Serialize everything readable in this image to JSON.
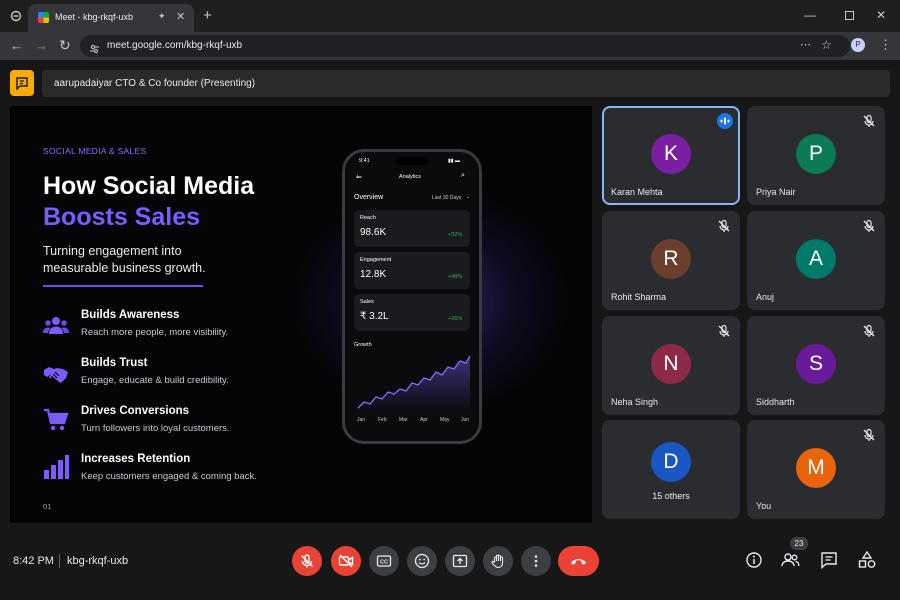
{
  "browser": {
    "tab_title": "Meet - kbg-rkqf-uxb",
    "url": "meet.google.com/kbg-rkqf-uxb",
    "profile_initial": "P"
  },
  "meet": {
    "presenting_label": "aarupadaiyar CTO & Co founder (Presenting)",
    "time": "8:42 PM",
    "meeting_code": "kbg-rkqf-uxb",
    "people_count": "23"
  },
  "slide": {
    "eyebrow": "SOCIAL MEDIA & SALES",
    "title_line1": "How Social Media",
    "title_line2": "Boosts Sales",
    "subtitle_line1": "Turning engagement into",
    "subtitle_line2": "measurable business growth.",
    "features": [
      {
        "title": "Builds Awareness",
        "desc": "Reach more people, more visibility.",
        "icon": "people-icon"
      },
      {
        "title": "Builds Trust",
        "desc": "Engage, educate & build credibility.",
        "icon": "handshake-icon"
      },
      {
        "title": "Drives Conversions",
        "desc": "Turn followers into loyal customers.",
        "icon": "cart-icon"
      },
      {
        "title": "Increases Retention",
        "desc": "Keep customers engaged & coming back.",
        "icon": "bar-chart-icon"
      }
    ],
    "page_number": "01",
    "phone": {
      "status_time": "9:41",
      "header": "Analytics",
      "overview": "Overview",
      "range": "Last 30 Days",
      "cards": [
        {
          "label": "Reach",
          "value": "98.6K",
          "change": "+32%"
        },
        {
          "label": "Engagement",
          "value": "12.8K",
          "change": "+48%"
        },
        {
          "label": "Sales",
          "value": "₹ 3.2L",
          "change": "+26%"
        }
      ],
      "growth_label": "Growth",
      "months": [
        "Jan",
        "Feb",
        "Mar",
        "Apr",
        "May",
        "Jun"
      ]
    }
  },
  "participants": [
    {
      "initial": "K",
      "name": "Karan Mehta",
      "color": "#7b1fa2",
      "state": "speaking"
    },
    {
      "initial": "P",
      "name": "Priya Nair",
      "color": "#0b7a55",
      "state": "muted"
    },
    {
      "initial": "R",
      "name": "Rohit Sharma",
      "color": "#6b3e2e",
      "state": "muted"
    },
    {
      "initial": "A",
      "name": "Anuj",
      "color": "#00796b",
      "state": "muted"
    },
    {
      "initial": "N",
      "name": "Neha Singh",
      "color": "#8e2a48",
      "state": "muted"
    },
    {
      "initial": "S",
      "name": "Siddharth",
      "color": "#6a1b9a",
      "state": "muted"
    },
    {
      "initial": "D",
      "name": "15 others",
      "color": "#1a56c4",
      "state": "none"
    },
    {
      "initial": "M",
      "name": "You",
      "color": "#e8630a",
      "state": "muted"
    }
  ],
  "colors": {
    "accent_purple": "#7c5cff",
    "positive_green": "#34a853",
    "control_red": "#ea4335",
    "speaking_blue": "#8ab4f8"
  }
}
